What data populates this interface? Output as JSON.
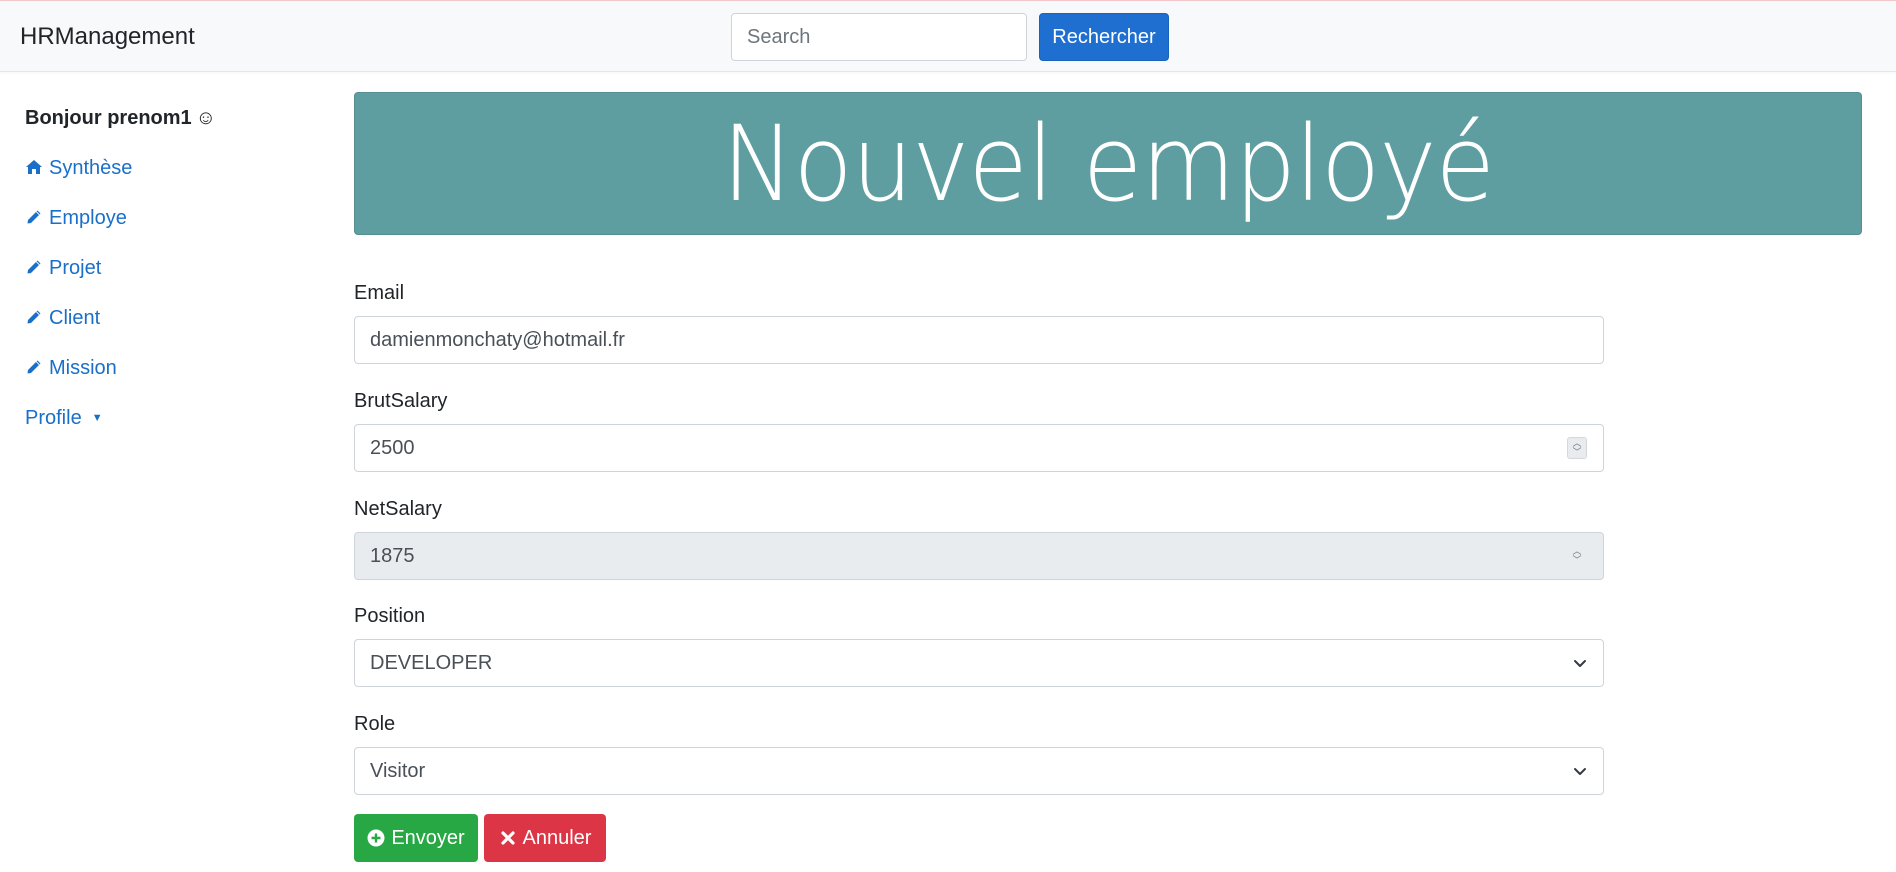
{
  "app": {
    "brand": "HRManagement"
  },
  "search": {
    "placeholder": "Search",
    "button_label": "Rechercher"
  },
  "sidebar": {
    "greeting": "Bonjour prenom1",
    "greeting_emoji": "☺",
    "items": [
      {
        "label": "Synthèse",
        "icon": "home-icon"
      },
      {
        "label": "Employe",
        "icon": "pencil-icon"
      },
      {
        "label": "Projet",
        "icon": "pencil-icon"
      },
      {
        "label": "Client",
        "icon": "pencil-icon"
      },
      {
        "label": "Mission",
        "icon": "pencil-icon"
      },
      {
        "label": "Profile",
        "icon": "caret-down-icon"
      }
    ]
  },
  "page": {
    "title": "Nouvel employé"
  },
  "form": {
    "email": {
      "label": "Email",
      "value": "damienmonchaty@hotmail.fr"
    },
    "brut_salary": {
      "label": "BrutSalary",
      "value": "2500"
    },
    "net_salary": {
      "label": "NetSalary",
      "value": "1875"
    },
    "position": {
      "label": "Position",
      "value": "DEVELOPER"
    },
    "role": {
      "label": "Role",
      "value": "Visitor"
    },
    "submit_label": "Envoyer",
    "cancel_label": "Annuler"
  },
  "colors": {
    "banner": "#5f9ea0",
    "primary": "#1f6fd1",
    "success": "#28a745",
    "danger": "#dc3545",
    "link": "#1a6fc9"
  }
}
